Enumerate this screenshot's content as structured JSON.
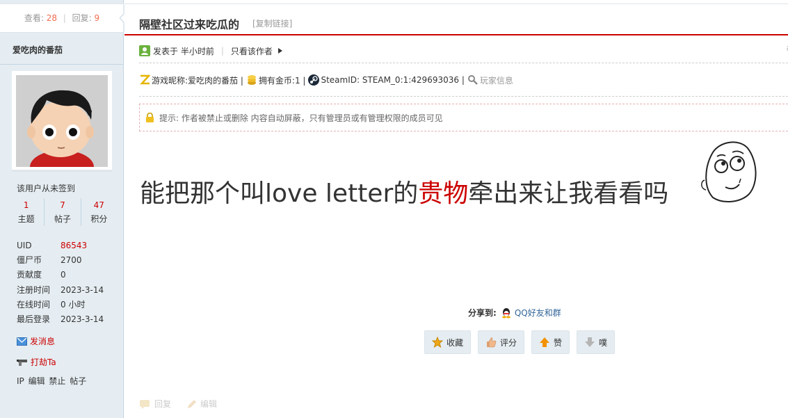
{
  "side": {
    "views_label": "查看:",
    "views": "28",
    "replies_label": "回复:",
    "replies": "9",
    "username": "爱吃肉的番茄",
    "checkin": "该用户从未签到",
    "counts": [
      {
        "value": "1",
        "label": "主题"
      },
      {
        "value": "7",
        "label": "帖子"
      },
      {
        "value": "47",
        "label": "积分"
      }
    ],
    "info": [
      {
        "key": "UID",
        "value": "86543"
      },
      {
        "key": "僵尸币",
        "value": "2700"
      },
      {
        "key": "贡献度",
        "value": "0"
      },
      {
        "key": "注册时间",
        "value": "2023-3-14"
      },
      {
        "key": "在线时间",
        "value": "0 小时"
      },
      {
        "key": "最后登录",
        "value": "2023-3-14"
      }
    ],
    "send_message": "发消息",
    "hit_ta": "打劫Ta",
    "admin_links": "IP 编辑 禁止 帖子"
  },
  "thread": {
    "title": "隔壁社区过来吃瓜的",
    "copy_link": "[复制链接]"
  },
  "post": {
    "posted_prefix": "发表于",
    "posted_time": "半小时前",
    "author_only": "只看该作者",
    "game_nick": "游戏昵称:爱吃肉的番茄 |",
    "coins": "拥有金币:1 |",
    "steam_id": "SteamID: STEAM_0:1:429693036 |",
    "player_info": "玩家信息",
    "notice": "提示: 作者被禁止或删除 内容自动屏蔽，只有管理员或有管理权限的成员可见",
    "content_before": "能把那个叫love letter的",
    "content_highlight": "贵物",
    "content_after": "牵出来让我看看吗",
    "share_label": "分享到:",
    "share_qq": "QQ好友和群",
    "actions": {
      "favorite": "收藏",
      "rate": "评分",
      "like": "赞",
      "dislike": "噗"
    },
    "reply": "回复",
    "edit": "编辑"
  },
  "colors": {
    "accent_red": "#cc0000",
    "side_bg": "#e5edf2",
    "link_blue": "#336699"
  }
}
